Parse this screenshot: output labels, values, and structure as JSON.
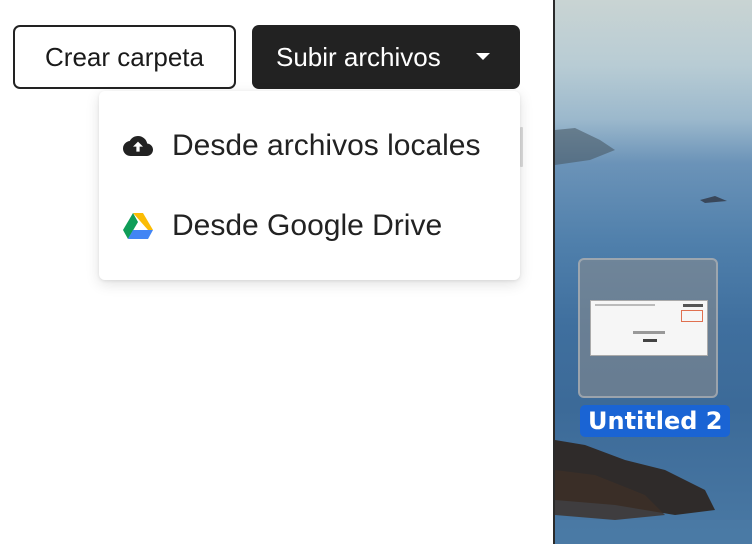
{
  "toolbar": {
    "create_folder_label": "Crear carpeta",
    "upload_label": "Subir archivos"
  },
  "upload_menu": {
    "items": [
      {
        "label": "Desde archivos locales",
        "icon": "cloud-upload-icon"
      },
      {
        "label": "Desde Google Drive",
        "icon": "google-drive-icon"
      }
    ]
  },
  "desktop": {
    "file_label": "Untitled 2",
    "file_icon": "document-thumbnail-icon"
  },
  "colors": {
    "primary_button_bg": "#222222",
    "selection_label_bg": "#1a64d4"
  }
}
